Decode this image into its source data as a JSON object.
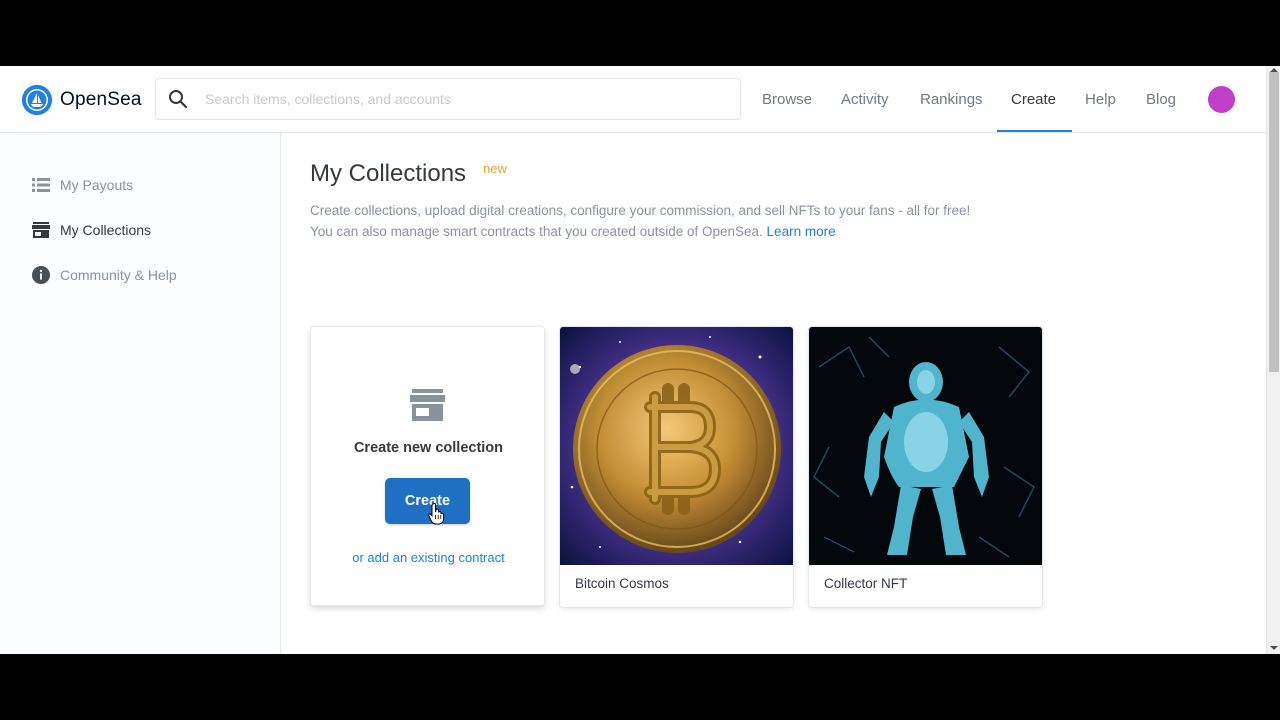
{
  "header": {
    "logo_text": "OpenSea",
    "search_placeholder": "Search items, collections, and accounts",
    "nav": [
      {
        "label": "Browse"
      },
      {
        "label": "Activity"
      },
      {
        "label": "Rankings"
      },
      {
        "label": "Create",
        "active": true
      },
      {
        "label": "Help"
      },
      {
        "label": "Blog"
      }
    ],
    "avatar_color": "#c13ec9"
  },
  "sidebar": {
    "items": [
      {
        "label": "My Payouts",
        "icon": "list-icon"
      },
      {
        "label": "My Collections",
        "icon": "storefront-icon",
        "active": true
      },
      {
        "label": "Community & Help",
        "icon": "info-icon"
      }
    ]
  },
  "main": {
    "title": "My Collections",
    "badge": "new",
    "description_line1": "Create collections, upload digital creations, configure your commission, and sell NFTs to your fans - all for free!",
    "description_line2": "You can also manage smart contracts that you created outside of OpenSea.",
    "learn_more": "Learn more",
    "create_card": {
      "title": "Create new collection",
      "button": "Create",
      "link": "or add an existing contract"
    },
    "collections": [
      {
        "name": "Bitcoin Cosmos"
      },
      {
        "name": "Collector NFT"
      }
    ]
  },
  "colors": {
    "accent": "#2081e2",
    "button": "#1f6fc5",
    "badge": "#f2a12a"
  }
}
